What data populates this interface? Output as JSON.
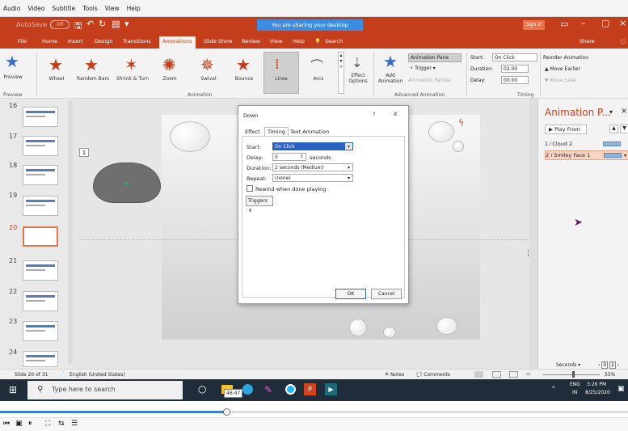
{
  "player_menu": [
    "Audio",
    "Video",
    "Subtitle",
    "Tools",
    "View",
    "Help"
  ],
  "titlebar": {
    "autosave": "AutoSave",
    "autosave_state": "Off",
    "share_banner": "You are sharing your desktop",
    "sign_in": "Sign in"
  },
  "tabs": [
    "File",
    "Home",
    "Insert",
    "Design",
    "Transitions",
    "Animations",
    "Slide Show",
    "Review",
    "View",
    "Help"
  ],
  "search_tab": "Search",
  "share": "Share",
  "ribbon": {
    "preview": "Preview",
    "effects": [
      "Wheel",
      "Random Bars",
      "Shrink & Turn",
      "Zoom",
      "Swivel",
      "Bounce",
      "Lines",
      "Arcs"
    ],
    "effect_options": "Effect Options",
    "add_animation": "Add Animation",
    "animation_pane": "Animation Pane",
    "trigger": "Trigger",
    "animation_painter": "Animation Painter",
    "start_label": "Start:",
    "start_value": "On Click",
    "duration_label": "Duration:",
    "duration_value": "02.00",
    "delay_label": "Delay:",
    "delay_value": "00.00",
    "reorder": "Reorder Animation",
    "move_earlier": "Move Earlier",
    "move_later": "Move Later",
    "groups": {
      "preview": "Preview",
      "animation": "Animation",
      "advanced": "Advanced Animation",
      "timing": "Timing"
    }
  },
  "thumbs": [
    "16",
    "17",
    "18",
    "19",
    "20",
    "21",
    "22",
    "23",
    "24"
  ],
  "cloud_tag": "1",
  "dialog": {
    "title": "Down",
    "help": "?",
    "close": "X",
    "tabs": [
      "Effect",
      "Timing",
      "Text Animation"
    ],
    "start_label": "Start:",
    "start_value": "On Click",
    "delay_label": "Delay:",
    "delay_value": "0",
    "delay_unit": "seconds",
    "duration_label": "Duration:",
    "duration_value": "2 seconds (Medium)",
    "repeat_label": "Repeat:",
    "repeat_value": "(none)",
    "rewind_label": "Rewind when done playing",
    "triggers": "Triggers",
    "ok": "OK",
    "cancel": "Cancel"
  },
  "anim_pane": {
    "title": "Animation P...",
    "play_from": "Play From",
    "items": [
      {
        "num": "1",
        "name": "Cloud 2"
      },
      {
        "num": "2",
        "name": "Smiley Face 1"
      }
    ],
    "seconds": "Seconds",
    "timeline_start": "0",
    "timeline_end": "2"
  },
  "status": {
    "slide": "Slide 20 of 31",
    "language": "English (United States)",
    "notes": "Notes",
    "comments": "Comments",
    "zoom": "55%"
  },
  "taskbar": {
    "search_placeholder": "Type here to search",
    "lang": "ENG",
    "region": "IN",
    "time": "3:26 PM",
    "date": "8/25/2020"
  },
  "video": {
    "timestamp": "46:47",
    "progress": 0.36
  },
  "accent": "#c43e1c"
}
